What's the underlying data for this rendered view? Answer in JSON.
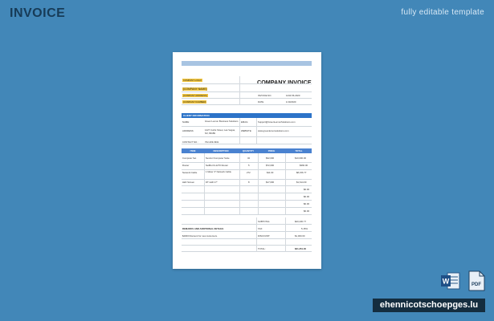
{
  "page": {
    "title": "INVOICE",
    "subtitle": "fully editable template",
    "brand": "ehennicotschoepges.lu"
  },
  "invoice": {
    "company_logo": "COMPANY LOGO",
    "company_name": "[COMPANY NAME]",
    "company_address": "[COMPANY ADDRESS]",
    "company_number": "[COMPANY NUMBER]",
    "title": "COMPANY INVOICE",
    "invoice_no_label": "INVOICE NO.",
    "invoice_no": "1234-56-2020",
    "date_label": "DATE",
    "date": "1/10/2020",
    "client_header": "CLIENT INFORMATION",
    "name_label": "NAME:",
    "name_value": "Green Lemon Business Solutions",
    "address_label": "ADDRESS:",
    "address_value": "1427 Curtis Street, Las Vegas, NV, 89189",
    "email_label": "EMAIL:",
    "email_value": "Support@GreenLemonSolutions.com",
    "website_label": "WEBSITE:",
    "website_value": "www.greenlemonsolutions.com",
    "contact_label": "CONTACT NO.:",
    "contact_value": "702-209-3941",
    "columns": [
      "ITEM",
      "DESCRIPTION",
      "QUANTITY",
      "PRICE",
      "TOTAL"
    ],
    "items": [
      {
        "item": "Computer Set",
        "desc": "NextLvl Computer Suite",
        "qty": "32",
        "price": "$32,000",
        "total": "$10,000.00"
      },
      {
        "item": "Router",
        "desc": "NetBut FL1270 Router",
        "qty": "5",
        "price": "$72,000",
        "total": "$360.00"
      },
      {
        "item": "Network Cable",
        "desc": "1 Meter 3\" Network Cable",
        "qty": "272",
        "price": "$11.00",
        "total": "$8,156.77"
      },
      {
        "item": "LED Screen",
        "desc": "DT LED 17\"",
        "qty": "8",
        "price": "$17,000",
        "total": "$1,614.00"
      }
    ],
    "empty_totals": [
      "$0.00",
      "$0.00",
      "$0.00",
      "$0.00"
    ],
    "subtotal_label": "SUBTOTAL:",
    "subtotal_value": "$20,230.77",
    "remarks_label": "REMARKS AND ADDITIONAL DETAILS",
    "tax_label": "TAX:",
    "tax_value": "5.15%",
    "remarks_value": "$4000 Discount for new customers.",
    "discount_label": "DISCOUNT:",
    "discount_value": "$1,000.00",
    "total_label": "TOTAL:",
    "total_value": "$21,251.00"
  }
}
